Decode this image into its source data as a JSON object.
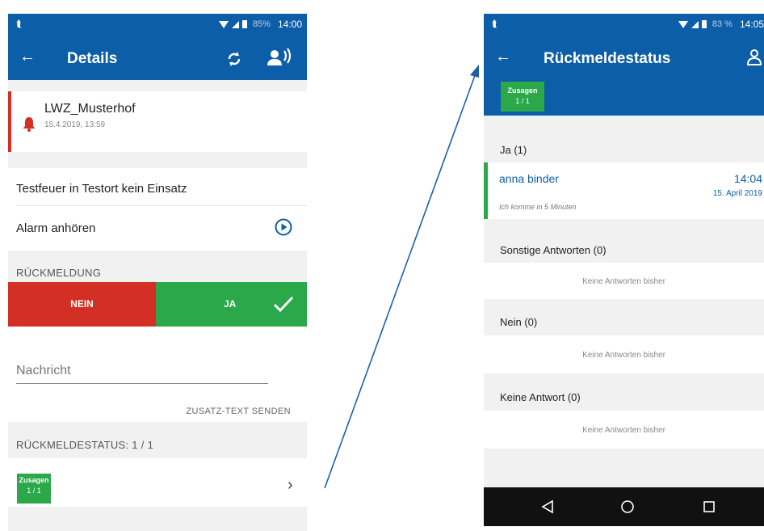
{
  "left": {
    "status": {
      "time": "14:00",
      "battery": "85%"
    },
    "appbar": {
      "title": "Details",
      "back_icon": "←"
    },
    "alarm": {
      "name": "LWZ_Musterhof",
      "date": "15.4.2019, 13:59"
    },
    "message": "Testfeuer in Testort kein Einsatz",
    "listen_label": "Alarm anhören",
    "feedback_header": "RÜCKMELDUNG",
    "buttons": {
      "no": "NEIN",
      "yes": "JA"
    },
    "nachricht_placeholder": "Nachricht",
    "send_extra_label": "ZUSATZ-TEXT SENDEN",
    "status_header": "RÜCKMELDESTATUS: 1 / 1",
    "badge": {
      "label": "Zusagen",
      "count": "1 / 1"
    }
  },
  "right": {
    "status": {
      "time": "14:05",
      "battery": "83 %"
    },
    "appbar": {
      "title": "Rückmeldestatus",
      "back_icon": "←"
    },
    "badge": {
      "label": "Zusagen",
      "count": "1 / 1"
    },
    "sections": {
      "ja": "Ja (1)",
      "sonstige": "Sonstige Antworten (0)",
      "nein": "Nein (0)",
      "keine": "Keine Antwort (0)"
    },
    "entry": {
      "name": "anna binder",
      "time": "14:04",
      "date": "15. April 2019",
      "note": "Ich komme in 5 Minuten"
    },
    "empty_text": "Keine Antworten bisher"
  },
  "colors": {
    "primary": "#0d5ea8",
    "red": "#d32f24",
    "green": "#2aa84a",
    "nav": "#111111"
  }
}
